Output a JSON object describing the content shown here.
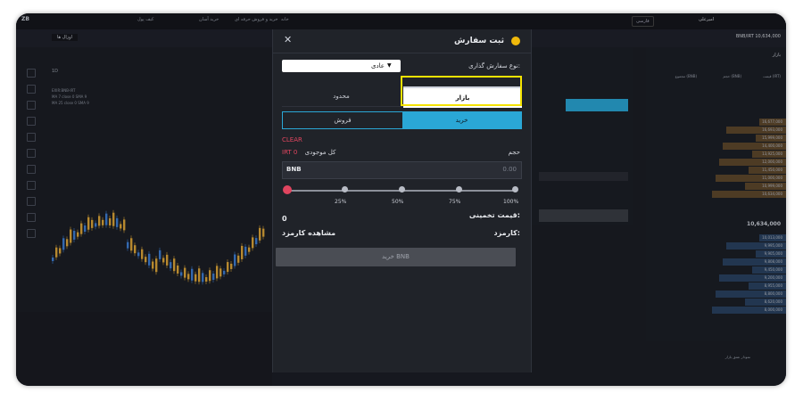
{
  "topbar": {
    "brand": "ZB",
    "nav": [
      "خانه",
      "خرید و فروش حرفه ای",
      "خرید آسان",
      "کیف پول"
    ],
    "lang": "فارسی",
    "user": "امیرعلی"
  },
  "market": {
    "ticker": "BNB/IRT 10,634,000",
    "dropdown": "اوزال ها"
  },
  "chart": {
    "pair": "EXIR:BNB-IRT",
    "timeframe": "1D",
    "legend1": "MA 7 close 0 SMA 9",
    "legend2": "MA 25 close 0 SMA 9",
    "xlabels": [
      "15",
      "آگوست",
      "15",
      "Sep",
      "15",
      "Oct"
    ],
    "footer": "(UTC+3:30) 13:24:24"
  },
  "orderbook": {
    "title": "بازار",
    "headers": [
      "مجموع (BNB)",
      "حجم (BNB)",
      "قیمت (IRT)"
    ],
    "asks": [
      "16,677,000",
      "16,693,000",
      "15,999,000",
      "14,400,000",
      "13,925,000",
      "12,000,000",
      "11,450,000",
      "11,000,000",
      "10,999,000",
      "10,634,000"
    ],
    "mid": "10,634,000",
    "bids": [
      "10,013,000",
      "9,995,000",
      "9,905,000",
      "9,808,000",
      "9,450,000",
      "9,200,000",
      "8,955,000",
      "8,800,000",
      "8,620,000",
      "8,000,000"
    ]
  },
  "modal": {
    "title": "ثبت سفارش",
    "order_type_label": "نوع سفارش گذاری:",
    "order_type_value": "عادی",
    "tabs": {
      "market": "بازار",
      "limit": "محدود"
    },
    "sides": {
      "buy": "خرید",
      "sell": "فروش"
    },
    "clear": "CLEAR",
    "volume_label": "حجم",
    "available_label": "کل موجودی",
    "available_value": "IRT 0",
    "currency": "BNB",
    "amount": "0.00",
    "percents": [
      "100%",
      "75%",
      "50%",
      "25%"
    ],
    "estimated_label": "قیمت تخمینی:",
    "estimated_value": "0",
    "fee_label": "کارمزد:",
    "fee_link": "مشاهده کارمزد",
    "submit": "خرید BNB"
  },
  "chart_extra": {
    "depth_label": "نمودار عمق بازار"
  },
  "accent": {
    "buy": "#2aa7d6",
    "highlight": "#f5e300",
    "danger": "#e0455f"
  }
}
